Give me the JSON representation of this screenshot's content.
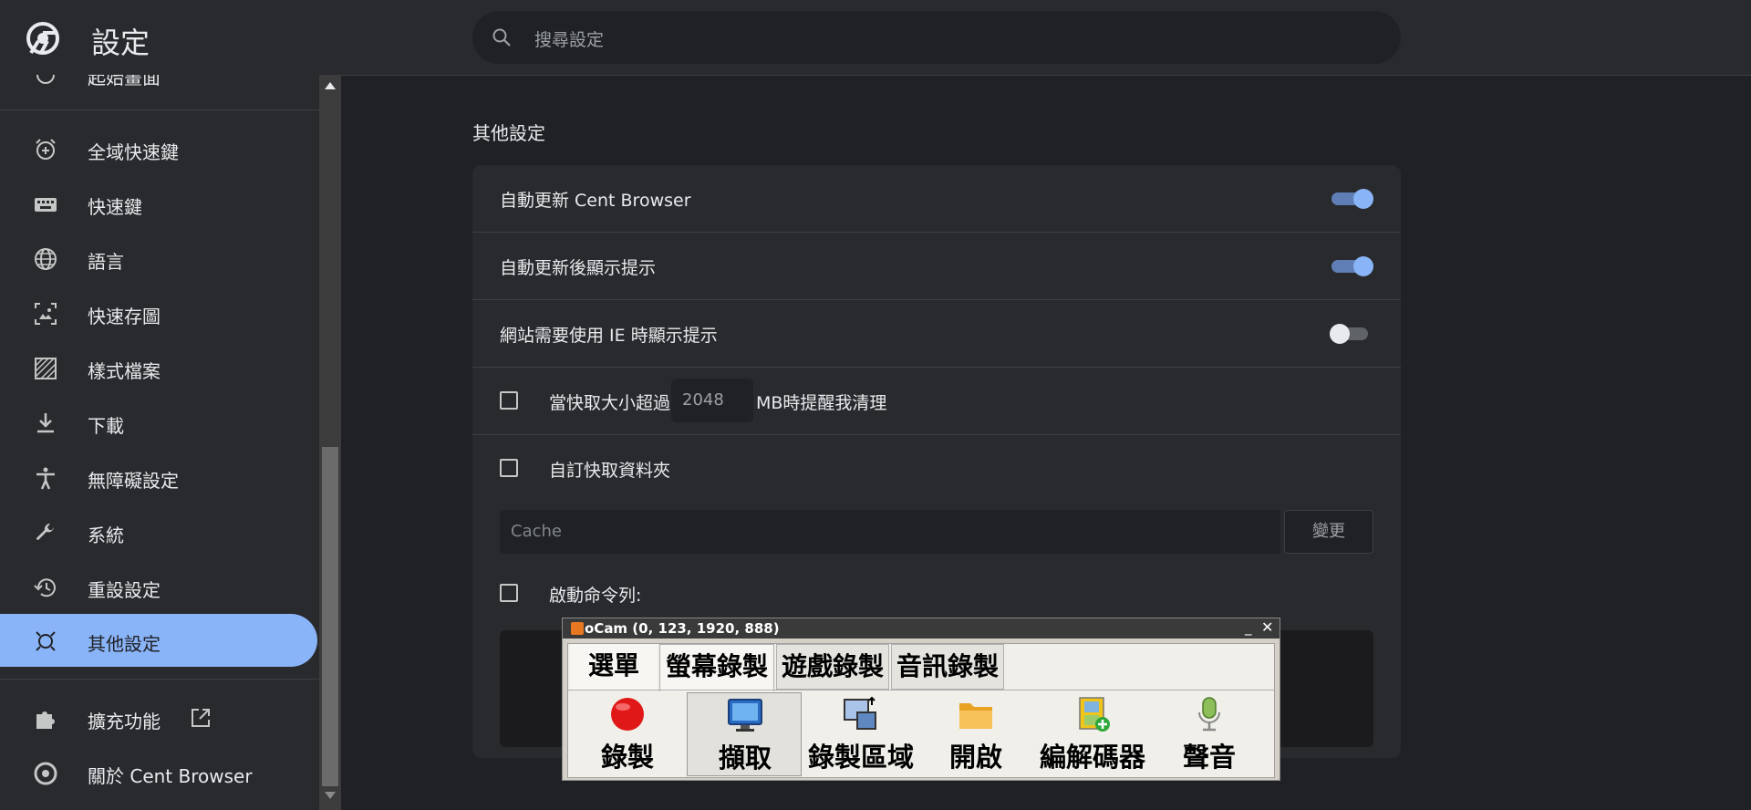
{
  "header": {
    "title": "設定",
    "search_placeholder": "搜尋設定"
  },
  "sidebar": {
    "partial_item": "起始畫面",
    "items": [
      {
        "label": "全域快速鍵",
        "icon": "alarm-add-icon"
      },
      {
        "label": "快速鍵",
        "icon": "keyboard-icon"
      },
      {
        "label": "語言",
        "icon": "globe-icon"
      },
      {
        "label": "快速存圖",
        "icon": "image-save-icon"
      },
      {
        "label": "樣式檔案",
        "icon": "texture-icon"
      },
      {
        "label": "下載",
        "icon": "download-icon"
      },
      {
        "label": "無障礙設定",
        "icon": "accessibility-icon"
      },
      {
        "label": "系統",
        "icon": "wrench-icon"
      },
      {
        "label": "重設設定",
        "icon": "history-icon"
      },
      {
        "label": "其他設定",
        "icon": "other-settings-icon",
        "active": true
      }
    ],
    "extensions_label": "擴充功能",
    "about_label": "關於 Cent Browser"
  },
  "main": {
    "section_title": "其他設定",
    "rows": [
      {
        "label": "自動更新 Cent Browser",
        "toggle": true
      },
      {
        "label": "自動更新後顯示提示",
        "toggle": true
      },
      {
        "label": "網站需要使用 IE 時顯示提示",
        "toggle": false
      }
    ],
    "cache_warning": {
      "checked": false,
      "label_before": "當快取大小超過",
      "value": "2048",
      "label_after": "MB時提醒我清理"
    },
    "custom_cache": {
      "checked": false,
      "label": "自訂快取資料夾",
      "path_placeholder": "Cache",
      "change_button": "變更"
    },
    "command_line": {
      "checked": false,
      "label": "啟動命令列:"
    }
  },
  "ocam": {
    "title": "oCam (0, 123, 1920, 888)",
    "tabs": [
      "選單",
      "螢幕錄製",
      "遊戲錄製",
      "音訊錄製"
    ],
    "selected_tab": "螢幕錄製",
    "tools": [
      "錄製",
      "擷取",
      "錄製區域",
      "開啟",
      "編解碼器",
      "聲音"
    ],
    "pressed_tool": "擷取"
  },
  "colors": {
    "background": "#202124",
    "surface": "#292a2d",
    "accent": "#8ab4f8",
    "text": "#e8eaed"
  }
}
